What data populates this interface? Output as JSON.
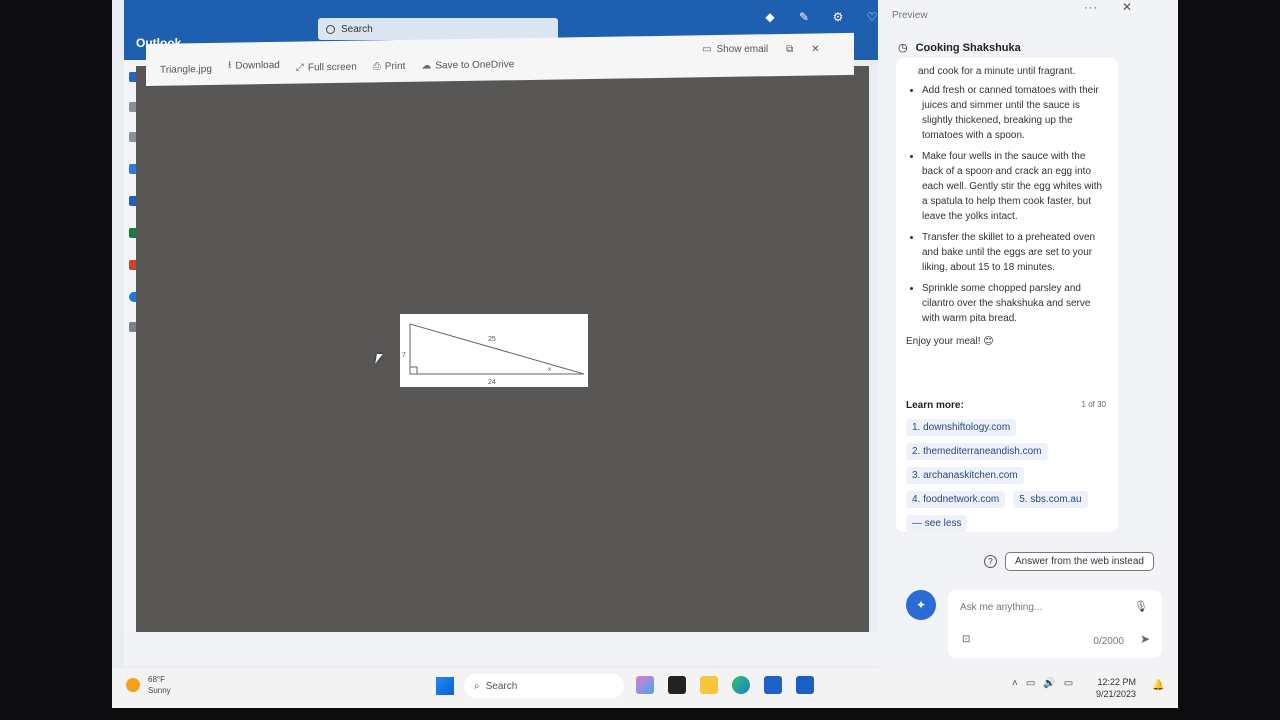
{
  "app": {
    "name": "Outlook"
  },
  "titlebar": {
    "search_placeholder": "Search"
  },
  "viewer": {
    "file_name": "Triangle.jpg",
    "download": "Download",
    "full_screen": "Full screen",
    "print": "Print",
    "save_onedrive": "Save to OneDrive",
    "show_email": "Show email"
  },
  "triangle": {
    "hypotenuse": "25",
    "side_a": "7",
    "side_b": "24",
    "angle_label": "x"
  },
  "pane": {
    "title": "Preview",
    "topic": "Cooking Shakshuka",
    "lead": "and cook for a minute until fragrant.",
    "bullets": [
      "Add fresh or canned tomatoes with their juices and simmer until the sauce is slightly thickened, breaking up the tomatoes with a spoon.",
      "Make four wells in the sauce with the back of a spoon and crack an egg into each well. Gently stir the egg whites with a spatula to help them cook faster, but leave the yolks intact.",
      "Transfer the skillet to a preheated oven and bake until the eggs are set to your liking, about 15 to 18 minutes.",
      "Sprinkle some chopped parsley and cilantro over the shakshuka and serve with warm pita bread."
    ],
    "enjoy": "Enjoy your meal! 😊",
    "learn_more": "Learn more:",
    "count": "1 of 30",
    "links": [
      "1. downshiftology.com",
      "2. themediterraneandish.com",
      "3. archanaskitchen.com",
      "4. foodnetwork.com",
      "5. sbs.com.au",
      "— see less"
    ],
    "answer_web": "Answer from the web instead",
    "ask_placeholder": "Ask me anything...",
    "char_count": "0/2000"
  },
  "taskbar": {
    "temp": "68°F",
    "condition": "Sunny",
    "search": "Search",
    "time": "12:22 PM",
    "date": "9/21/2023"
  }
}
